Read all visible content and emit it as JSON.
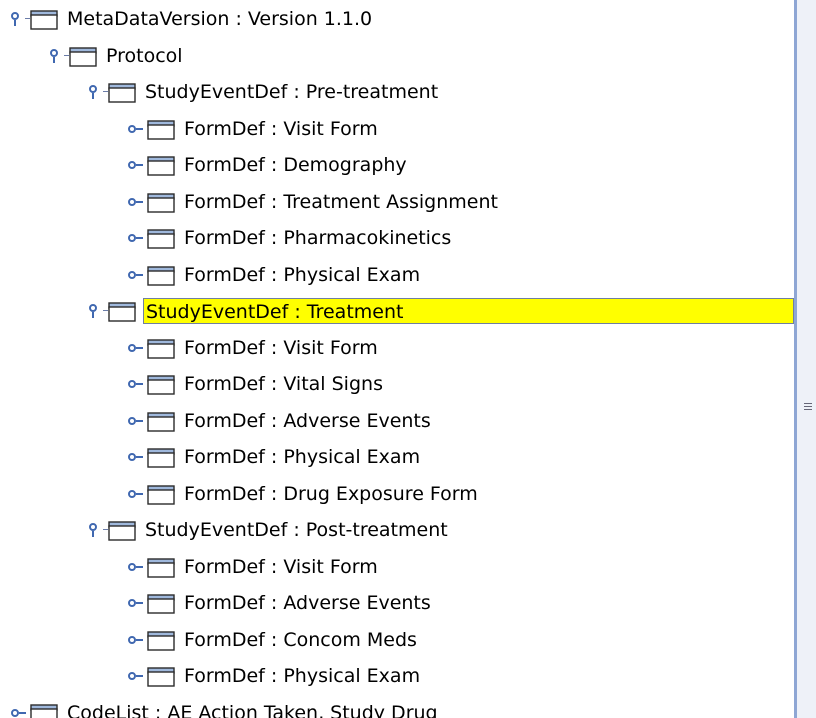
{
  "tree": {
    "nodes": [
      {
        "label": "MetaDataVersion : Version 1.1.0",
        "level": 0,
        "expanded": true
      },
      {
        "label": "Protocol",
        "level": 1,
        "expanded": true
      },
      {
        "label": "StudyEventDef : Pre-treatment",
        "level": 2,
        "expanded": true
      },
      {
        "label": "FormDef : Visit Form",
        "level": 3,
        "expanded": false
      },
      {
        "label": "FormDef : Demography",
        "level": 3,
        "expanded": false
      },
      {
        "label": "FormDef : Treatment Assignment",
        "level": 3,
        "expanded": false
      },
      {
        "label": "FormDef : Pharmacokinetics",
        "level": 3,
        "expanded": false
      },
      {
        "label": "FormDef : Physical Exam",
        "level": 3,
        "expanded": false
      },
      {
        "label": "StudyEventDef : Treatment",
        "level": 2,
        "expanded": true,
        "selected": true
      },
      {
        "label": "FormDef : Visit Form",
        "level": 3,
        "expanded": false
      },
      {
        "label": "FormDef : Vital Signs",
        "level": 3,
        "expanded": false
      },
      {
        "label": "FormDef : Adverse Events",
        "level": 3,
        "expanded": false
      },
      {
        "label": "FormDef : Physical Exam",
        "level": 3,
        "expanded": false
      },
      {
        "label": "FormDef : Drug Exposure Form",
        "level": 3,
        "expanded": false
      },
      {
        "label": "StudyEventDef : Post-treatment",
        "level": 2,
        "expanded": true
      },
      {
        "label": "FormDef : Visit Form",
        "level": 3,
        "expanded": false
      },
      {
        "label": "FormDef : Adverse Events",
        "level": 3,
        "expanded": false
      },
      {
        "label": "FormDef : Concom Meds",
        "level": 3,
        "expanded": false
      },
      {
        "label": "FormDef : Physical Exam",
        "level": 3,
        "expanded": false
      },
      {
        "label": "CodeList : AE Action Taken, Study Drug",
        "level": 0,
        "expanded": false
      }
    ]
  },
  "colors": {
    "selection": "#ffff00",
    "handle": "#4068b0",
    "folder_tab": "#9fb8dc",
    "folder_body": "#ffffff",
    "divider": "#8ea6d4"
  },
  "icons": {
    "expanded_handle": "expanded-handle-icon",
    "collapsed_handle": "collapsed-handle-icon",
    "node": "folder-icon",
    "divider_grip": "grip-icon"
  }
}
